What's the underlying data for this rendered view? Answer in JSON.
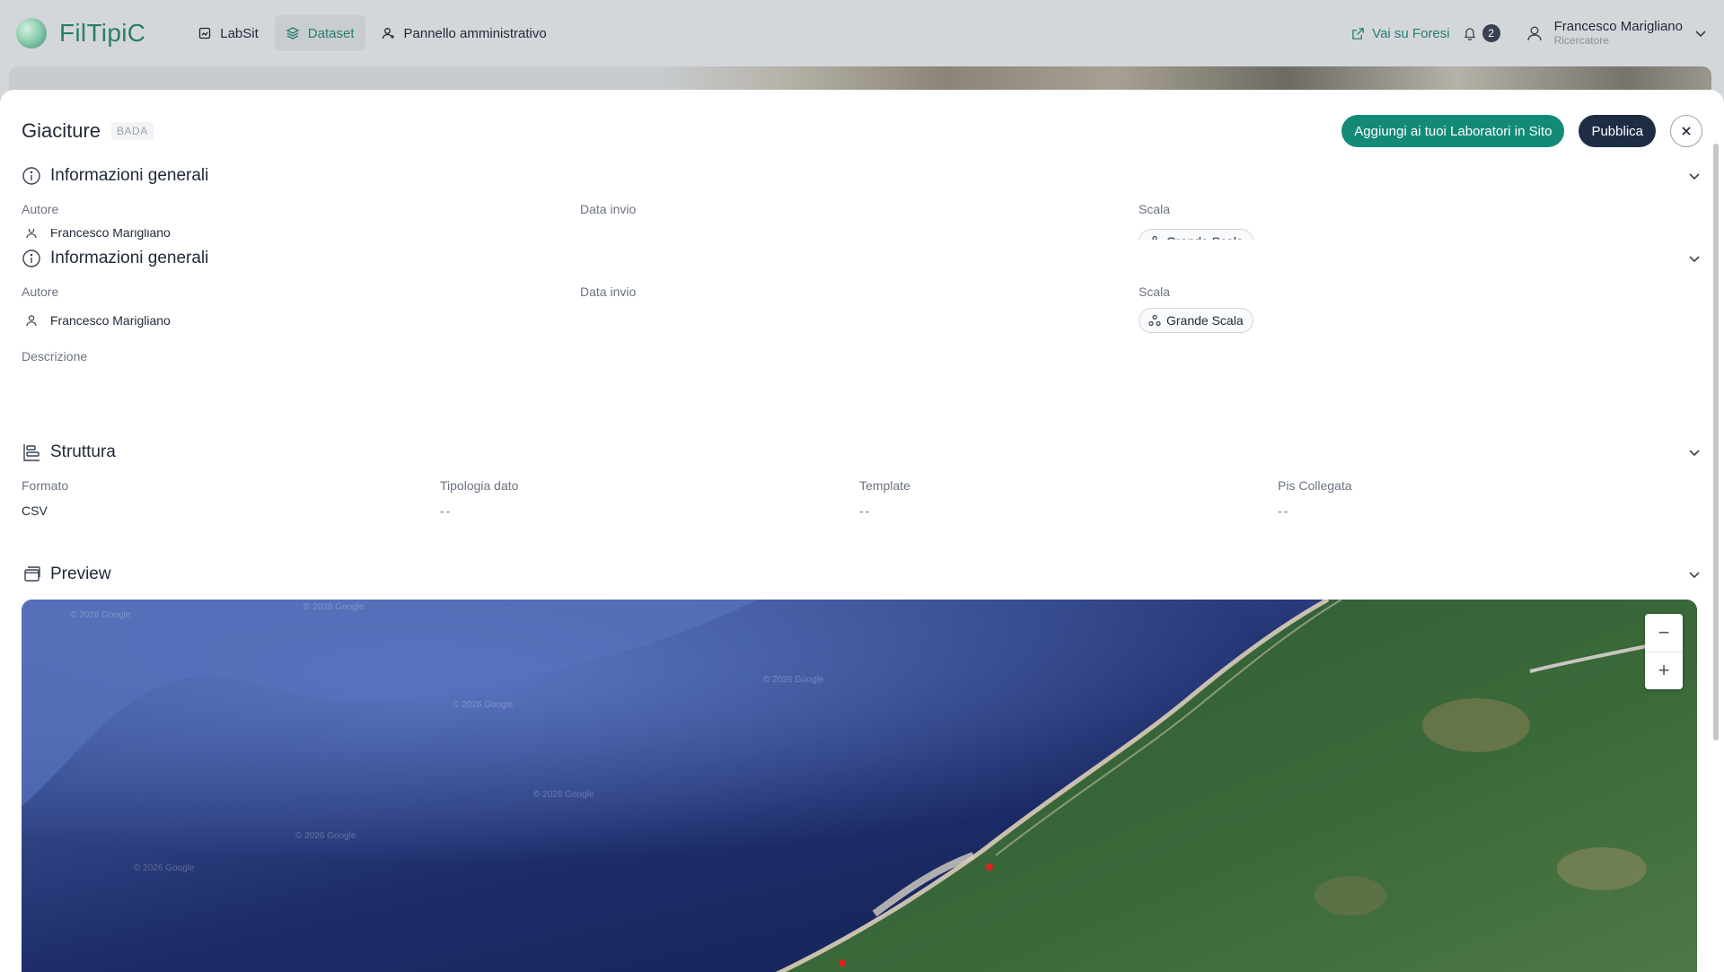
{
  "app": {
    "name": "FilTipiC"
  },
  "nav": [
    {
      "label": "LabSit",
      "icon": "labsit-icon",
      "active": false
    },
    {
      "label": "Dataset",
      "icon": "layers-icon",
      "active": true
    },
    {
      "label": "Pannello amministrativo",
      "icon": "admin-icon",
      "active": false
    }
  ],
  "topright": {
    "external_link": "Vai su Foresi",
    "notifications": "2",
    "user_name": "Francesco Marigliano",
    "user_role": "Ricercatore"
  },
  "panel": {
    "title": "Giaciture",
    "tag": "BADA",
    "add_button": "Aggiungi ai tuoi Laboratori in Sito",
    "publish_button": "Pubblica"
  },
  "general": {
    "title": "Informazioni generali",
    "author_label": "Autore",
    "author": "Francesco Marigliano",
    "date_label": "Data invio",
    "scale_label": "Scala",
    "scale": "Grande Scala",
    "description_label": "Descrizione"
  },
  "structure": {
    "title": "Struttura",
    "format_label": "Formato",
    "format": "CSV",
    "type_label": "Tipologia dato",
    "type": "--",
    "template_label": "Template",
    "template": "--",
    "pis_label": "Pis Collegata",
    "pis": "--"
  },
  "preview": {
    "title": "Preview"
  },
  "map": {
    "watermark": "© 2026 Google",
    "zoom_out": "−",
    "zoom_in": "+"
  },
  "colors": {
    "accent": "#138a76",
    "dark": "#1f2d44",
    "brand": "#2b7c6b"
  }
}
